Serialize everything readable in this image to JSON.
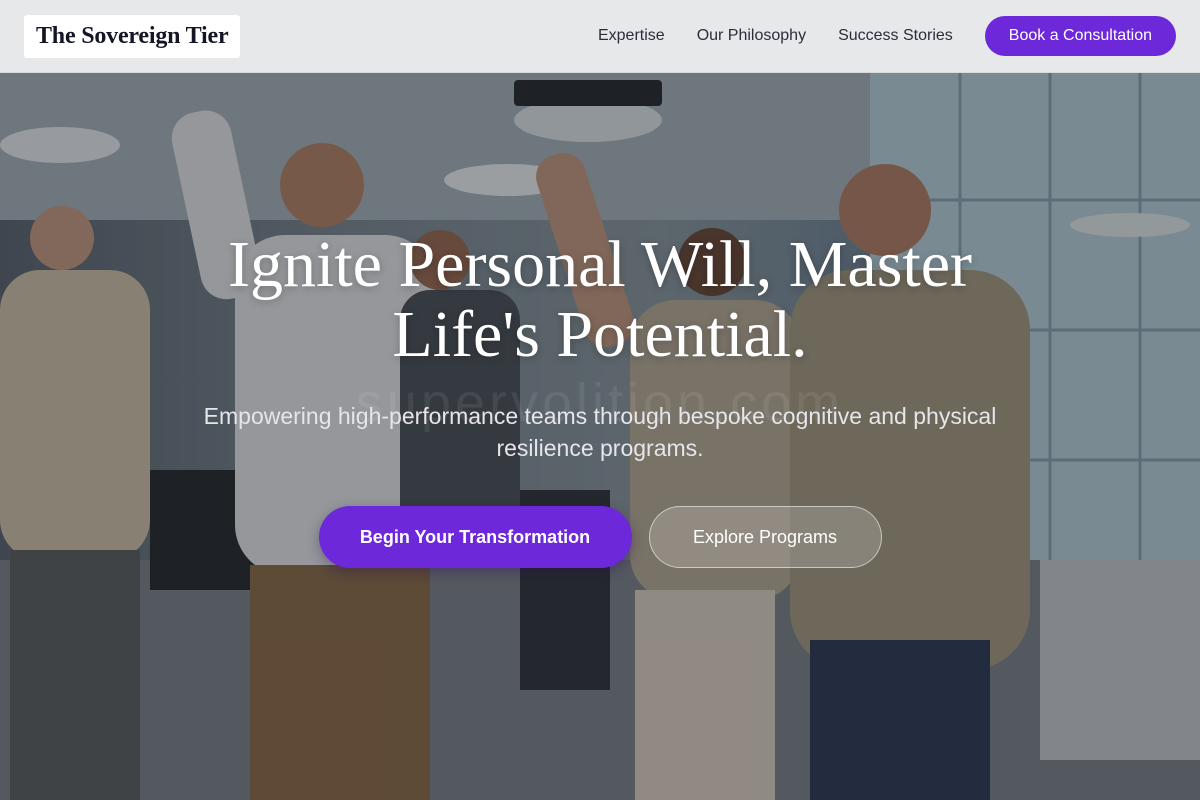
{
  "header": {
    "brand": "The Sovereign Tier",
    "nav": [
      {
        "label": "Expertise"
      },
      {
        "label": "Our Philosophy"
      },
      {
        "label": "Success Stories"
      }
    ],
    "cta_label": "Book a Consultation"
  },
  "hero": {
    "title": "Ignite Personal Will, Master Life's Potential.",
    "subtitle": "Empowering high-performance teams through bespoke cognitive and physical resilience programs.",
    "primary_button": "Begin Your Transformation",
    "secondary_button": "Explore Programs",
    "background_image": "office-team-celebrating-photo",
    "watermark": "supervolition.com"
  },
  "colors": {
    "accent": "#6d28d9",
    "header_bg": "#f0f1f2",
    "brand_text": "#141625"
  }
}
